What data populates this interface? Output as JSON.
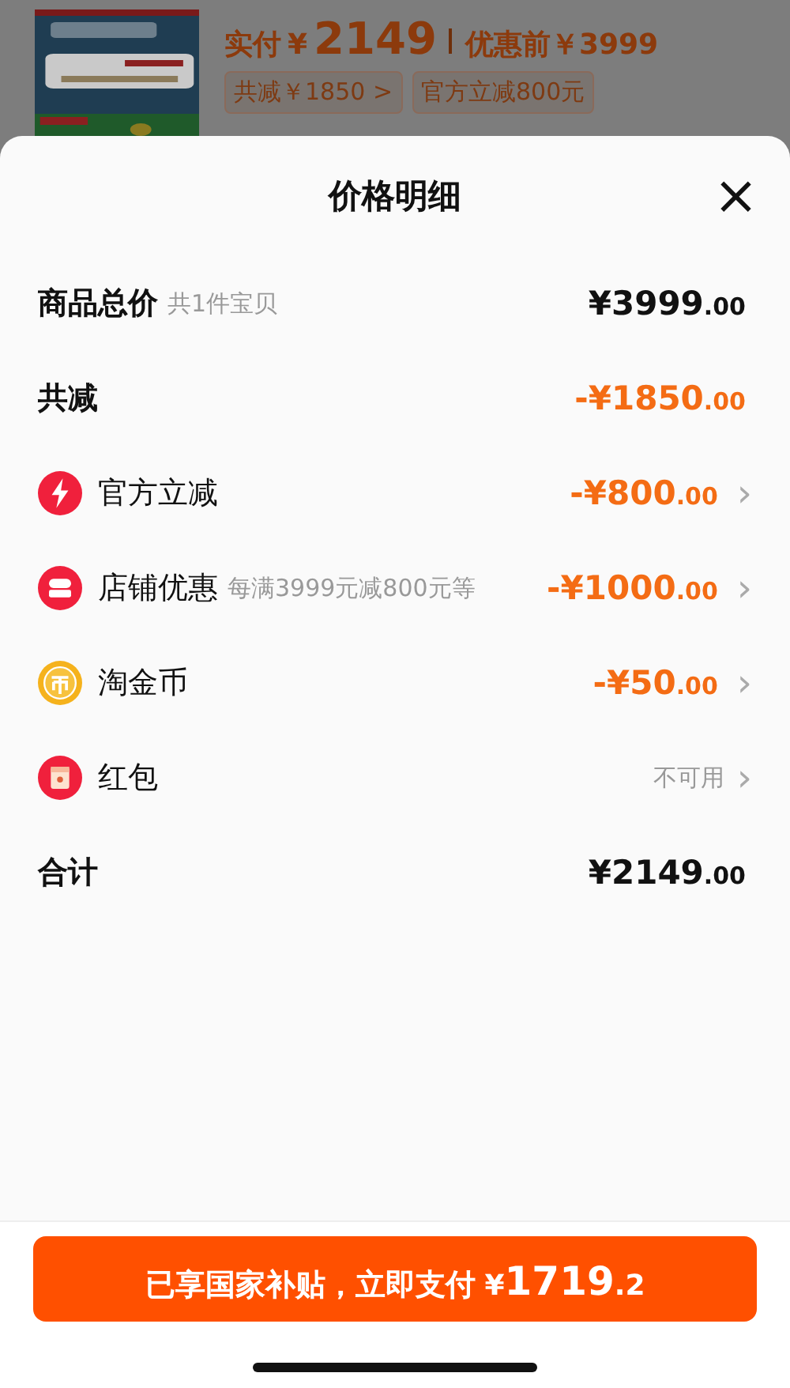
{
  "product_header": {
    "paid_label": "实付",
    "paid_currency": "¥",
    "paid_amount": "2149",
    "original_price": "优惠前￥3999",
    "tags": [
      {
        "label": "共减￥1850 >"
      },
      {
        "label": "官方立减800元"
      }
    ]
  },
  "sheet": {
    "title": "价格明细",
    "close": "×",
    "rows": [
      {
        "kind": "summary",
        "label": "商品总价",
        "note": "共1件宝贝",
        "amount": "¥3999",
        "cents": ".00"
      },
      {
        "kind": "deduction",
        "label": "共减",
        "amount": "-¥1850",
        "cents": ".00"
      },
      {
        "kind": "item",
        "label": "官方立减",
        "amount": "-¥800",
        "cents": ".00",
        "chevron": "›"
      },
      {
        "kind": "item",
        "label": "店铺优惠",
        "note": "每满3999元减800元等",
        "amount": "-¥1000",
        "cents": ".00",
        "chevron": "›"
      },
      {
        "kind": "item",
        "label": "淘金币",
        "amount": "-¥50",
        "cents": ".00",
        "chevron": "›"
      },
      {
        "kind": "item",
        "label": "红包",
        "status": "不可用",
        "chevron": "›"
      },
      {
        "kind": "summary",
        "label": "合计",
        "amount": "¥2149",
        "cents": ".00"
      }
    ],
    "pay_button": {
      "label": "已享国家补贴，立即支付",
      "currency": "¥",
      "amount": "1719",
      "cents": ".2"
    }
  }
}
